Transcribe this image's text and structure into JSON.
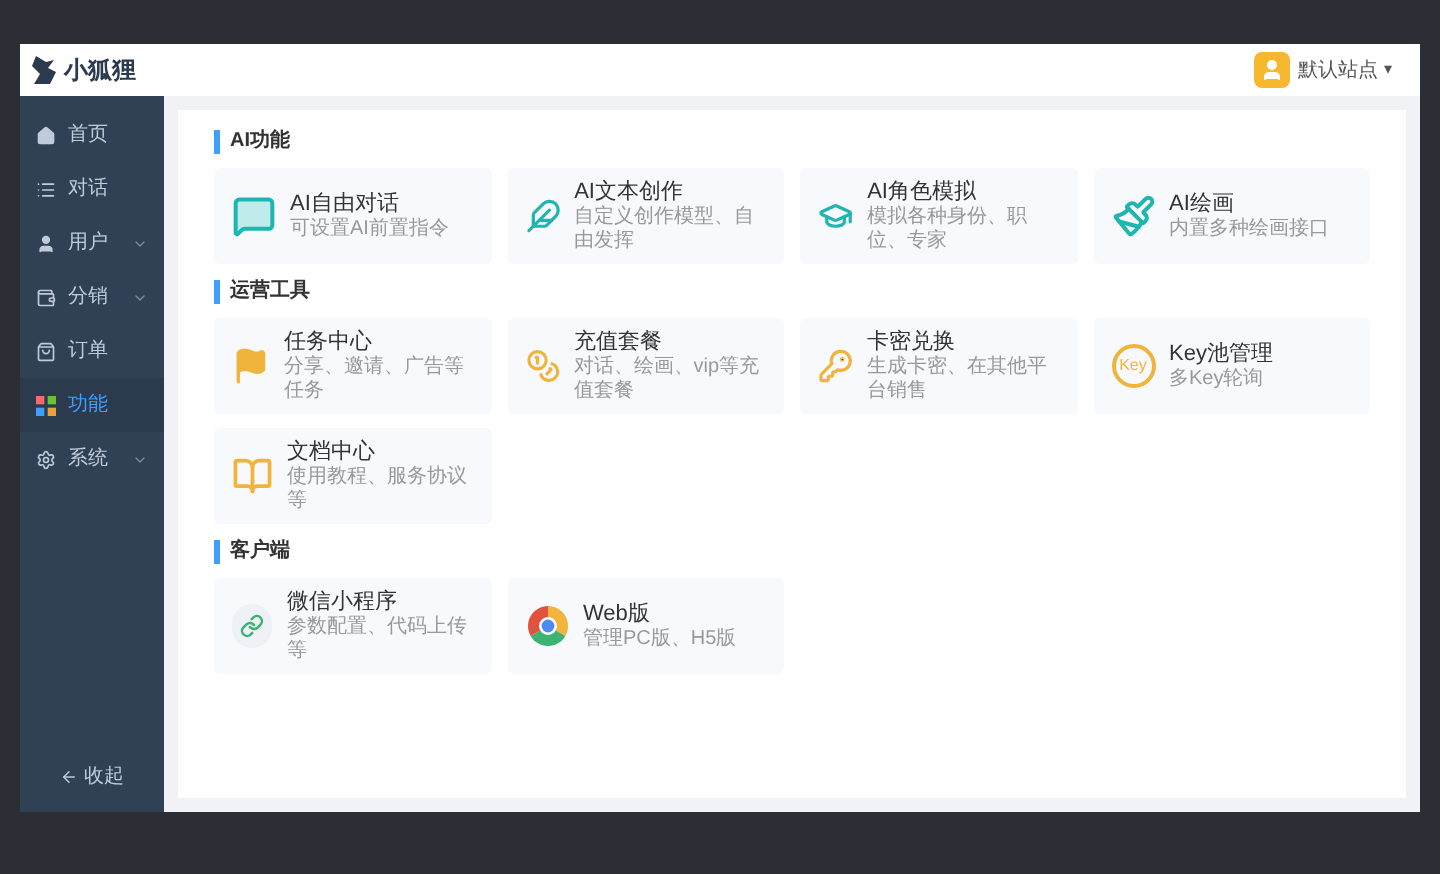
{
  "header": {
    "logo_text": "小狐狸",
    "site_name": "默认站点",
    "dropdown_caret": "▾"
  },
  "sidebar": {
    "items": [
      {
        "label": "首页",
        "expandable": false,
        "selected": false
      },
      {
        "label": "对话",
        "expandable": false,
        "selected": false
      },
      {
        "label": "用户",
        "expandable": true,
        "selected": false
      },
      {
        "label": "分销",
        "expandable": true,
        "selected": false
      },
      {
        "label": "订单",
        "expandable": false,
        "selected": false
      },
      {
        "label": "功能",
        "expandable": false,
        "selected": true
      },
      {
        "label": "系统",
        "expandable": true,
        "selected": false
      }
    ],
    "collapse": "收起"
  },
  "sections": [
    {
      "title": "AI功能",
      "items": [
        {
          "title": "AI自由对话",
          "subtitle": "可设置AI前置指令"
        },
        {
          "title": "AI文本创作",
          "subtitle": "自定义创作模型、自由发挥"
        },
        {
          "title": "AI角色模拟",
          "subtitle": "模拟各种身份、职位、专家"
        },
        {
          "title": "AI绘画",
          "subtitle": "内置多种绘画接口"
        }
      ]
    },
    {
      "title": "运营工具",
      "items": [
        {
          "title": "任务中心",
          "subtitle": "分享、邀请、广告等任务"
        },
        {
          "title": "充值套餐",
          "subtitle": "对话、绘画、vip等充值套餐"
        },
        {
          "title": "卡密兑换",
          "subtitle": "生成卡密、在其他平台销售"
        },
        {
          "title": "Key池管理",
          "subtitle": "多Key轮询",
          "icon_text": "Key"
        },
        {
          "title": "文档中心",
          "subtitle": "使用教程、服务协议等"
        }
      ]
    },
    {
      "title": "客户端",
      "items": [
        {
          "title": "微信小程序",
          "subtitle": "参数配置、代码上传等"
        },
        {
          "title": "Web版",
          "subtitle": "管理PC版、H5版"
        }
      ]
    }
  ]
}
